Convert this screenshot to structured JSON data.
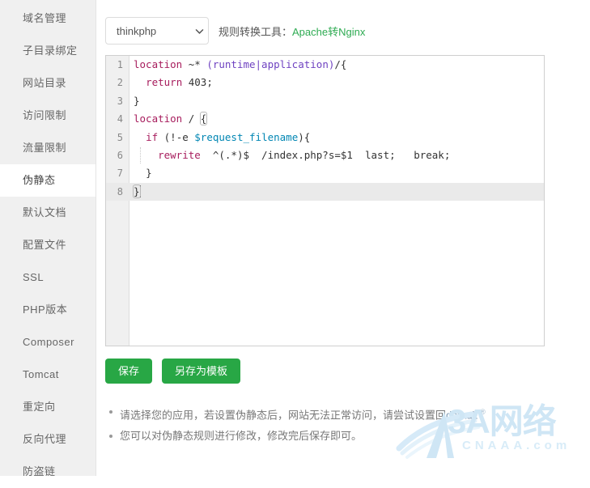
{
  "sidebar": {
    "items": [
      {
        "label": "域名管理",
        "active": false
      },
      {
        "label": "子目录绑定",
        "active": false
      },
      {
        "label": "网站目录",
        "active": false
      },
      {
        "label": "访问限制",
        "active": false
      },
      {
        "label": "流量限制",
        "active": false
      },
      {
        "label": "伪静态",
        "active": true
      },
      {
        "label": "默认文档",
        "active": false
      },
      {
        "label": "配置文件",
        "active": false
      },
      {
        "label": "SSL",
        "active": false
      },
      {
        "label": "PHP版本",
        "active": false
      },
      {
        "label": "Composer",
        "active": false
      },
      {
        "label": "Tomcat",
        "active": false
      },
      {
        "label": "重定向",
        "active": false
      },
      {
        "label": "反向代理",
        "active": false
      },
      {
        "label": "防盗链",
        "active": false
      }
    ]
  },
  "toolbar": {
    "select_value": "thinkphp",
    "select_options": [
      "thinkphp"
    ],
    "tool_label": "规则转换工具：",
    "tool_link": "Apache转Nginx",
    "link_color": "#2eab52"
  },
  "editor": {
    "lines": [
      {
        "n": "1",
        "text": "location ~* (runtime|application)/{"
      },
      {
        "n": "2",
        "text": "  return 403;"
      },
      {
        "n": "3",
        "text": "}"
      },
      {
        "n": "4",
        "text": "location / {"
      },
      {
        "n": "5",
        "text": "  if (!-e $request_filename){"
      },
      {
        "n": "6",
        "text": "    rewrite  ^(.*)$  /index.php?s=$1  last;   break;"
      },
      {
        "n": "7",
        "text": "  }"
      },
      {
        "n": "8",
        "text": "}"
      }
    ],
    "tokens": {
      "l1_kw": "location",
      "l1_op": " ~* ",
      "l1_grp": "(runtime|application)",
      "l1_tail": "/{",
      "l2_kw": "return",
      "l2_num": " 403;",
      "l3_text": "}",
      "l4_kw": "location",
      "l4_mid": " / ",
      "l4_brace": "{",
      "l5_kw": "if",
      "l5_mid": " (!-e ",
      "l5_var": "$request_filename",
      "l5_tail": "){",
      "l6_kw": "rewrite",
      "l6_tail": "  ^(.*)$  /index.php?s=$1  last;   break;",
      "l7_text": "}",
      "l8_text": "}"
    },
    "active_line": "8"
  },
  "buttons": {
    "save": "保存",
    "save_as_template": "另存为模板",
    "color": "#28a745"
  },
  "notes": {
    "items": [
      {
        "prefix": "请选择您的应用，若设置伪静态后，网站无法正常访问，请尝试设置回",
        "highlight": "default",
        "mark": "®"
      },
      {
        "prefix": "您可以对伪静态规则进行修改，修改完后保存即可。",
        "highlight": "",
        "mark": ""
      }
    ]
  },
  "watermark": {
    "brand": "3A网络",
    "domain": "CNAAA.com",
    "color": "#cfe6f5"
  }
}
